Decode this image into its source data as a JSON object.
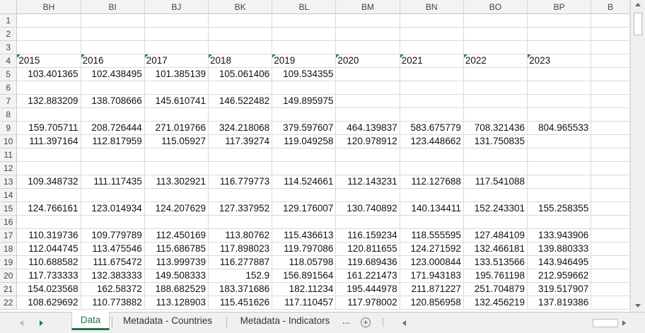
{
  "columns": [
    "BH",
    "BI",
    "BJ",
    "BK",
    "BL",
    "BM",
    "BN",
    "BO",
    "BP",
    "B"
  ],
  "rows": [
    {
      "num": "1",
      "cells": [
        "",
        "",
        "",
        "",
        "",
        "",
        "",
        "",
        ""
      ]
    },
    {
      "num": "2",
      "cells": [
        "",
        "",
        "",
        "",
        "",
        "",
        "",
        "",
        ""
      ]
    },
    {
      "num": "3",
      "cells": [
        "",
        "",
        "",
        "",
        "",
        "",
        "",
        "",
        ""
      ]
    },
    {
      "num": "4",
      "cells": [
        "2015",
        "2016",
        "2017",
        "2018",
        "2019",
        "2020",
        "2021",
        "2022",
        "2023"
      ]
    },
    {
      "num": "5",
      "cells": [
        "103.401365",
        "102.438495",
        "101.385139",
        "105.061406",
        "109.534355",
        "",
        "",
        "",
        ""
      ]
    },
    {
      "num": "6",
      "cells": [
        "",
        "",
        "",
        "",
        "",
        "",
        "",
        "",
        ""
      ]
    },
    {
      "num": "7",
      "cells": [
        "132.883209",
        "138.708666",
        "145.610741",
        "146.522482",
        "149.895975",
        "",
        "",
        "",
        ""
      ]
    },
    {
      "num": "8",
      "cells": [
        "",
        "",
        "",
        "",
        "",
        "",
        "",
        "",
        ""
      ]
    },
    {
      "num": "9",
      "cells": [
        "159.705711",
        "208.726444",
        "271.019766",
        "324.218068",
        "379.597607",
        "464.139837",
        "583.675779",
        "708.321436",
        "804.965533"
      ]
    },
    {
      "num": "10",
      "cells": [
        "111.397164",
        "112.817959",
        "115.05927",
        "117.39274",
        "119.049258",
        "120.978912",
        "123.448662",
        "131.750835",
        ""
      ]
    },
    {
      "num": "11",
      "cells": [
        "",
        "",
        "",
        "",
        "",
        "",
        "",
        "",
        ""
      ]
    },
    {
      "num": "12",
      "cells": [
        "",
        "",
        "",
        "",
        "",
        "",
        "",
        "",
        ""
      ]
    },
    {
      "num": "13",
      "cells": [
        "109.348732",
        "111.117435",
        "113.302921",
        "116.779773",
        "114.524661",
        "112.143231",
        "112.127688",
        "117.541088",
        ""
      ]
    },
    {
      "num": "14",
      "cells": [
        "",
        "",
        "",
        "",
        "",
        "",
        "",
        "",
        ""
      ]
    },
    {
      "num": "15",
      "cells": [
        "124.766161",
        "123.014934",
        "124.207629",
        "127.337952",
        "129.176007",
        "130.740892",
        "140.134411",
        "152.243301",
        "155.258355"
      ]
    },
    {
      "num": "16",
      "cells": [
        "",
        "",
        "",
        "",
        "",
        "",
        "",
        "",
        ""
      ]
    },
    {
      "num": "17",
      "cells": [
        "110.319736",
        "109.779789",
        "112.450169",
        "113.80762",
        "115.436613",
        "116.159234",
        "118.555595",
        "127.484109",
        "133.943906"
      ]
    },
    {
      "num": "18",
      "cells": [
        "112.044745",
        "113.475546",
        "115.686785",
        "117.898023",
        "119.797086",
        "120.811655",
        "124.271592",
        "132.466181",
        "139.880333"
      ]
    },
    {
      "num": "19",
      "cells": [
        "110.688582",
        "111.675472",
        "113.999739",
        "116.277887",
        "118.05798",
        "119.689436",
        "123.000844",
        "133.513566",
        "143.946495"
      ]
    },
    {
      "num": "20",
      "cells": [
        "117.733333",
        "132.383333",
        "149.508333",
        "152.9",
        "156.891564",
        "161.221473",
        "171.943183",
        "195.761198",
        "212.959662"
      ]
    },
    {
      "num": "21",
      "cells": [
        "154.023568",
        "162.58372",
        "188.682529",
        "183.371686",
        "182.11234",
        "195.444978",
        "211.871227",
        "251.704879",
        "319.517907"
      ]
    },
    {
      "num": "22",
      "cells": [
        "108.629692",
        "110.773882",
        "113.128903",
        "115.451626",
        "117.110457",
        "117.978002",
        "120.856958",
        "132.456219",
        "137.819386"
      ]
    }
  ],
  "tabs": [
    "Data",
    "Metadata - Countries",
    "Metadata - Indicators"
  ],
  "tab_overflow": "...",
  "add_sheet": "+",
  "colors": {
    "accent": "#1e7a3c",
    "header_bg": "#f3f3f3",
    "grid": "#dadada"
  }
}
